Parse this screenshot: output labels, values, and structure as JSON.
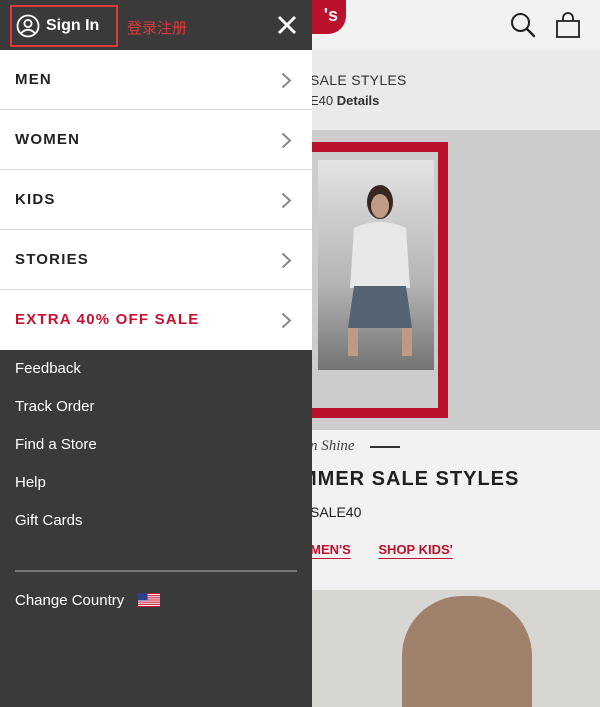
{
  "background": {
    "logo_text": "'s",
    "promo_line1": "SALE STYLES",
    "promo_line2_prefix": "E40",
    "promo_line2_link": "Details",
    "tagline": "n Shine",
    "headline": "MMER SALE STYLES",
    "promo_code": "SALE40",
    "links": [
      "OMEN'S",
      "SHOP KIDS'"
    ]
  },
  "drawer": {
    "signin_label": "Sign In",
    "annotation": "登录注册",
    "menu": [
      {
        "label": "MEN"
      },
      {
        "label": "WOMEN"
      },
      {
        "label": "KIDS"
      },
      {
        "label": "STORIES"
      },
      {
        "label": "EXTRA 40% OFF SALE",
        "highlight": true
      }
    ],
    "links": [
      "Feedback",
      "Track Order",
      "Find a Store",
      "Help",
      "Gift Cards"
    ],
    "country_label": "Change Country"
  },
  "colors": {
    "drawer_bg": "#3a3a3a",
    "brand_red": "#c41230",
    "annotation_red": "#e0393b"
  },
  "icons": [
    "user-icon",
    "close-icon",
    "chevron-right-icon",
    "us-flag-icon",
    "search-icon",
    "bag-icon"
  ]
}
